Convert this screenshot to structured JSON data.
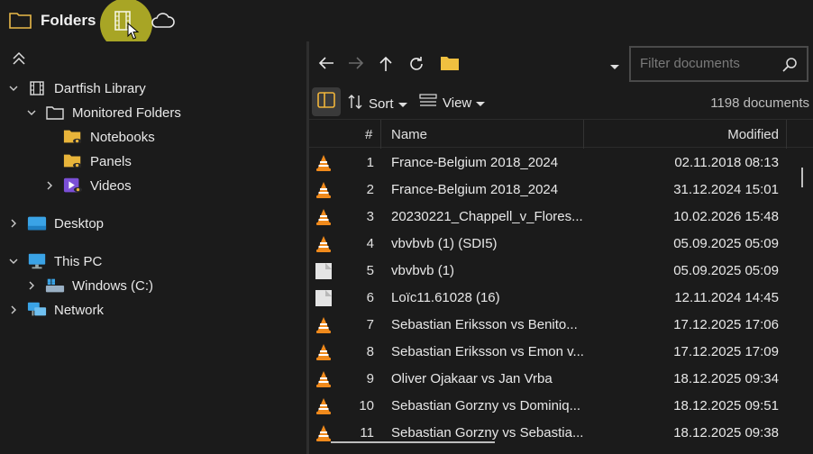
{
  "header": {
    "title": "Folders",
    "icons": [
      "folder-icon",
      "film-icon",
      "cloud-icon"
    ],
    "highlight_color": "#c8c428"
  },
  "tree": {
    "items": [
      {
        "label": "Dartfish Library",
        "icon": "film-icon",
        "expanded": true
      },
      {
        "label": "Monitored Folders",
        "icon": "folder-outline-icon",
        "expanded": true
      },
      {
        "label": "Notebooks",
        "icon": "folder-eye-icon"
      },
      {
        "label": "Panels",
        "icon": "folder-eye-icon"
      },
      {
        "label": "Videos",
        "icon": "videos-eye-icon",
        "expanded": false
      },
      {
        "label": "Desktop",
        "icon": "desktop-icon",
        "expanded": false
      },
      {
        "label": "This PC",
        "icon": "monitor-icon",
        "expanded": true
      },
      {
        "label": "Windows (C:)",
        "icon": "drive-icon",
        "expanded": false
      },
      {
        "label": "Network",
        "icon": "network-icon",
        "expanded": false
      }
    ]
  },
  "filter": {
    "placeholder": "Filter documents"
  },
  "toolbar": {
    "sort_label": "Sort",
    "view_label": "View",
    "doc_count": "1198 documents"
  },
  "table": {
    "columns": {
      "num": "#",
      "name": "Name",
      "modified": "Modified"
    },
    "rows": [
      {
        "num": "1",
        "name": "France-Belgium 2018_2024",
        "modified": "02.11.2018 08:13",
        "icon": "vlc-icon"
      },
      {
        "num": "2",
        "name": "France-Belgium 2018_2024",
        "modified": "31.12.2024 15:01",
        "icon": "vlc-icon"
      },
      {
        "num": "3",
        "name": "20230221_Chappell_v_Flores...",
        "modified": "10.02.2026 15:48",
        "icon": "vlc-icon"
      },
      {
        "num": "4",
        "name": "vbvbvb (1) (SDI5)",
        "modified": "05.09.2025 05:09",
        "icon": "vlc-icon"
      },
      {
        "num": "5",
        "name": "vbvbvb (1)",
        "modified": "05.09.2025 05:09",
        "icon": "generic-file-icon"
      },
      {
        "num": "6",
        "name": "Loïc11.61028 (16)",
        "modified": "12.11.2024 14:45",
        "icon": "generic-file-icon"
      },
      {
        "num": "7",
        "name": "Sebastian Eriksson vs Benito...",
        "modified": "17.12.2025 17:06",
        "icon": "vlc-icon"
      },
      {
        "num": "8",
        "name": "Sebastian Eriksson vs Emon v...",
        "modified": "17.12.2025 17:09",
        "icon": "vlc-icon"
      },
      {
        "num": "9",
        "name": "Oliver Ojakaar vs Jan Vrba",
        "modified": "18.12.2025 09:34",
        "icon": "vlc-icon"
      },
      {
        "num": "10",
        "name": "Sebastian Gorzny vs Dominiq...",
        "modified": "18.12.2025 09:51",
        "icon": "vlc-icon"
      },
      {
        "num": "11",
        "name": "Sebastian Gorzny vs Sebastia...",
        "modified": "18.12.2025 09:38",
        "icon": "vlc-icon"
      }
    ]
  }
}
